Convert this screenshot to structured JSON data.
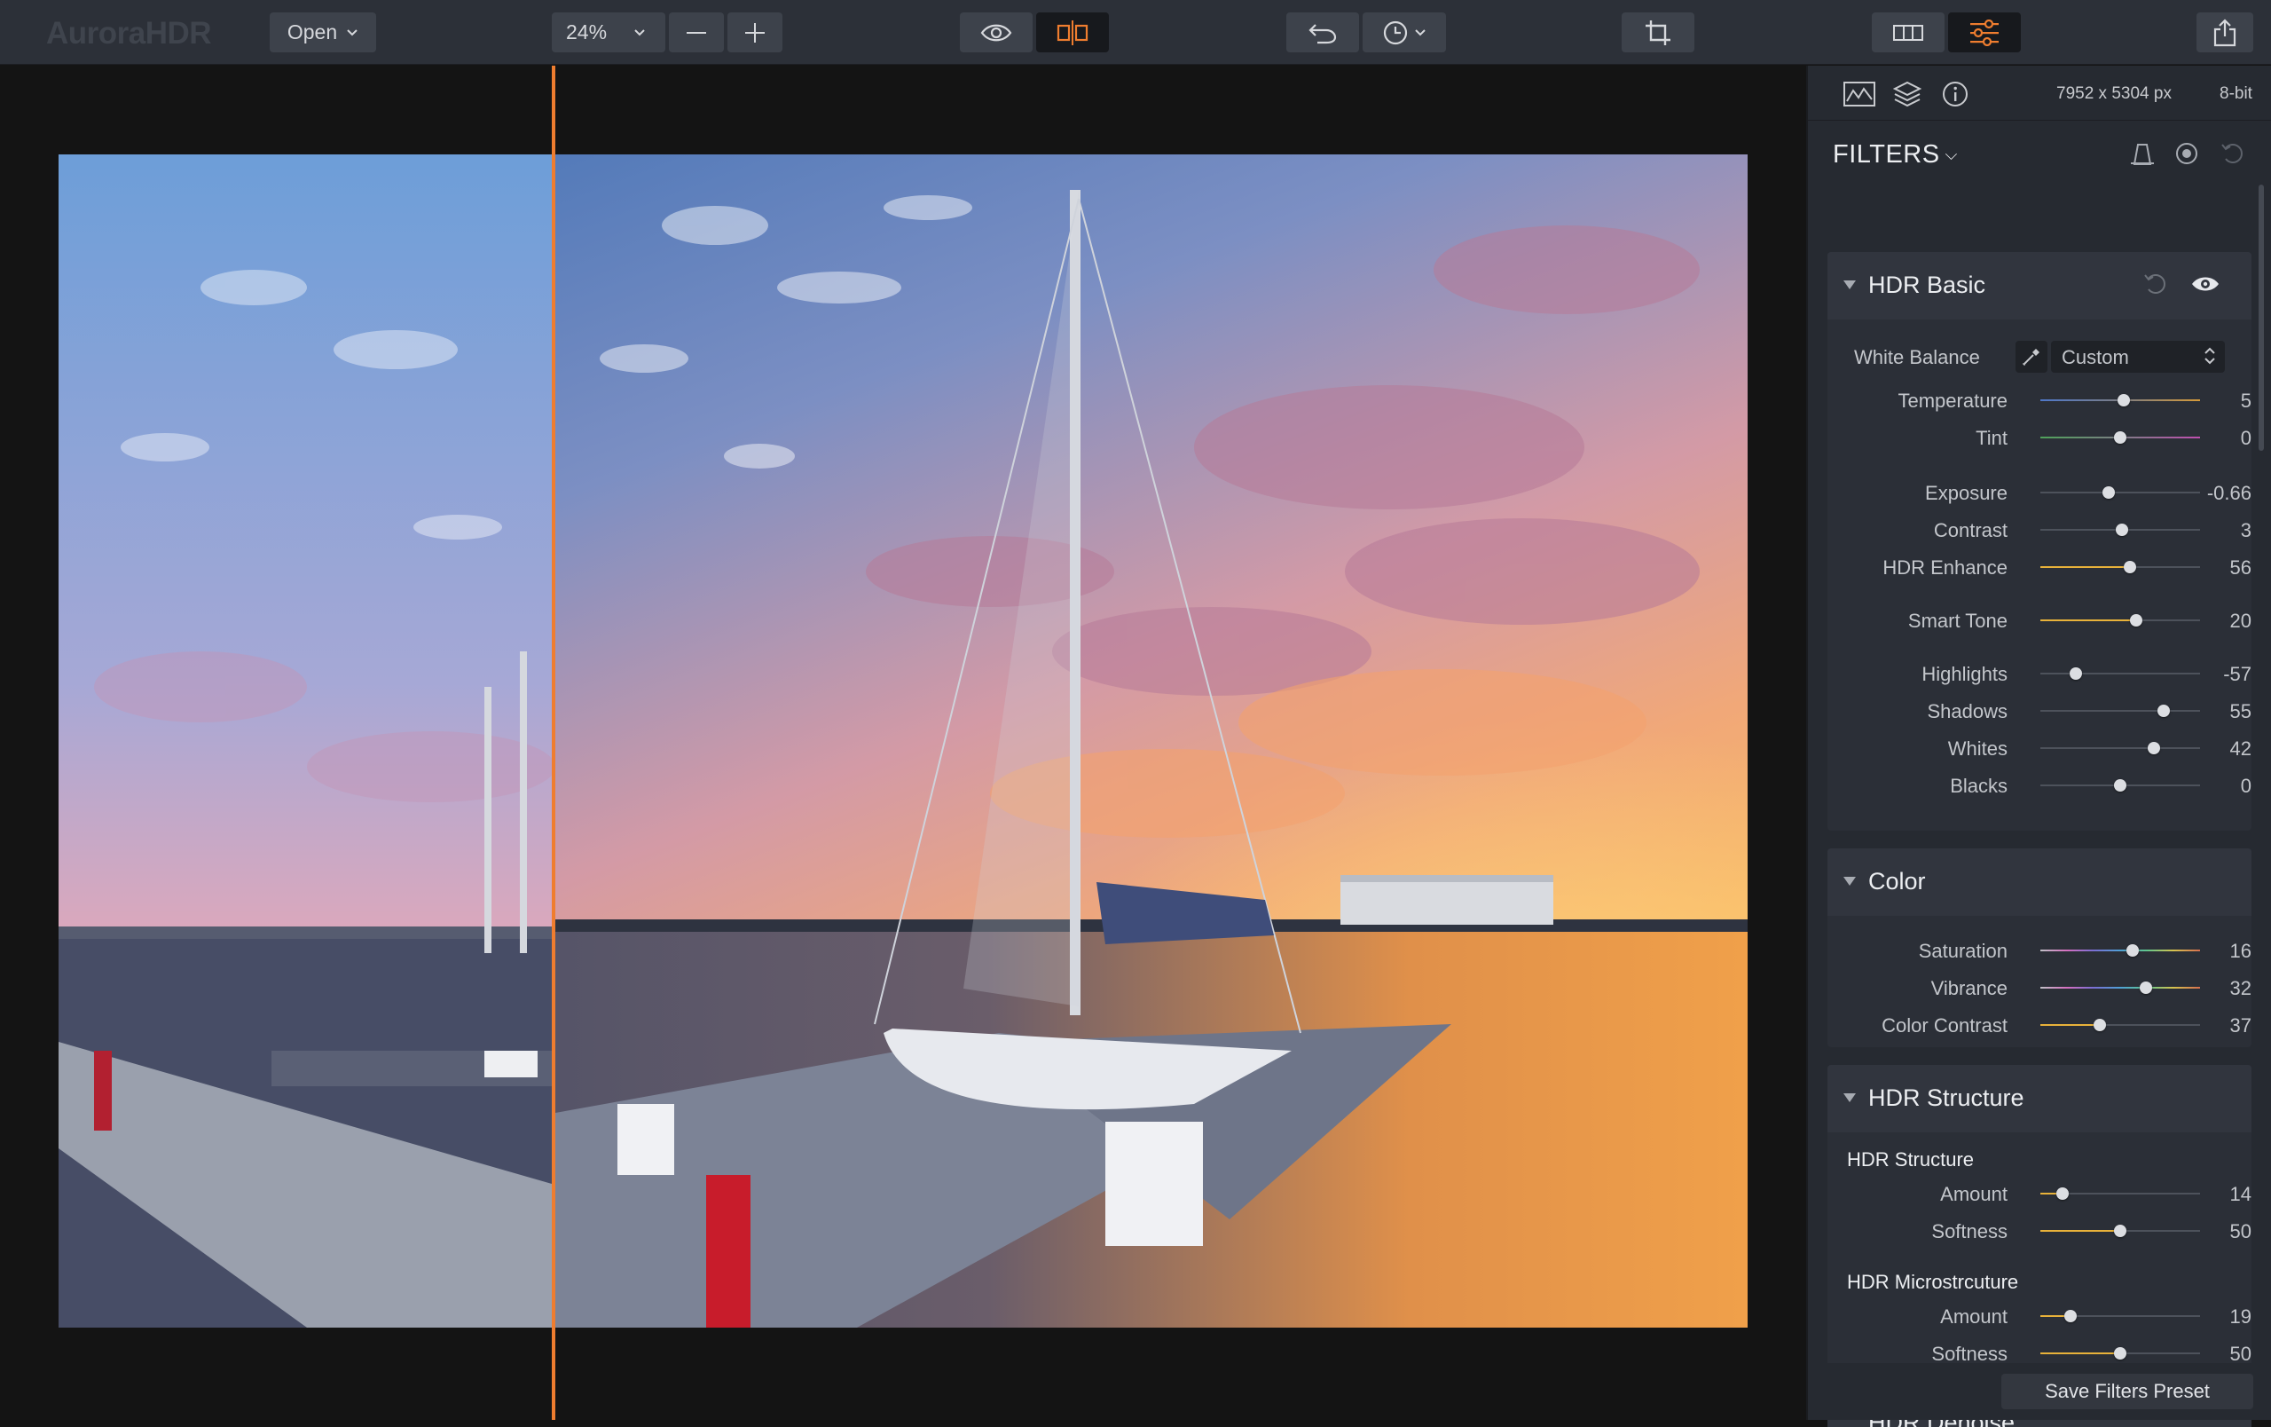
{
  "app": {
    "title": "AuroraHDR"
  },
  "toolbar": {
    "open_label": "Open",
    "zoom_value": "24%"
  },
  "panel": {
    "image_size": "7952 x 5304 px",
    "bit_depth": "8-bit",
    "filters_label": "FILTERS",
    "save_preset_label": "Save Filters Preset"
  },
  "hdr_basic": {
    "title": "HDR Basic",
    "white_balance": {
      "label": "White Balance",
      "value": "Custom"
    },
    "sliders": [
      {
        "label": "Temperature",
        "value": "5",
        "position": 0.52
      },
      {
        "label": "Tint",
        "value": "0",
        "position": 0.5
      },
      {
        "label": "Exposure",
        "value": "-0.66",
        "position": 0.43
      },
      {
        "label": "Contrast",
        "value": "3",
        "position": 0.51
      },
      {
        "label": "HDR Enhance",
        "value": "56",
        "position": 0.56
      },
      {
        "label": "Smart Tone",
        "value": "20",
        "position": 0.6
      },
      {
        "label": "Highlights",
        "value": "-57",
        "position": 0.22
      },
      {
        "label": "Shadows",
        "value": "55",
        "position": 0.77
      },
      {
        "label": "Whites",
        "value": "42",
        "position": 0.71
      },
      {
        "label": "Blacks",
        "value": "0",
        "position": 0.5
      }
    ]
  },
  "color": {
    "title": "Color",
    "sliders": [
      {
        "label": "Saturation",
        "value": "16",
        "position": 0.58
      },
      {
        "label": "Vibrance",
        "value": "32",
        "position": 0.66
      },
      {
        "label": "Color Contrast",
        "value": "37",
        "position": 0.37
      }
    ]
  },
  "hdr_structure": {
    "title": "HDR Structure",
    "group1": {
      "title": "HDR Structure",
      "sliders": [
        {
          "label": "Amount",
          "value": "14",
          "position": 0.14
        },
        {
          "label": "Softness",
          "value": "50",
          "position": 0.5
        }
      ]
    },
    "group2": {
      "title": "HDR Microstrcuture",
      "sliders": [
        {
          "label": "Amount",
          "value": "19",
          "position": 0.19
        },
        {
          "label": "Softness",
          "value": "50",
          "position": 0.5
        }
      ]
    }
  },
  "next_section": {
    "title": "HDR Denoise"
  },
  "colors": {
    "accent": "#ef7d2f",
    "toolbar_bg": "#2c3038",
    "panel_bg": "#262a31",
    "active_button": "#17191d"
  },
  "icons": [
    "caret-down-icon",
    "zoom-out-icon",
    "zoom-in-icon",
    "eye-icon",
    "compare-split-icon",
    "undo-icon",
    "history-icon",
    "crop-icon",
    "presets-panel-icon",
    "adjustments-icon",
    "share-icon",
    "histogram-icon",
    "layers-icon",
    "info-icon",
    "masking-icon",
    "lens-icon",
    "reset-icon"
  ]
}
